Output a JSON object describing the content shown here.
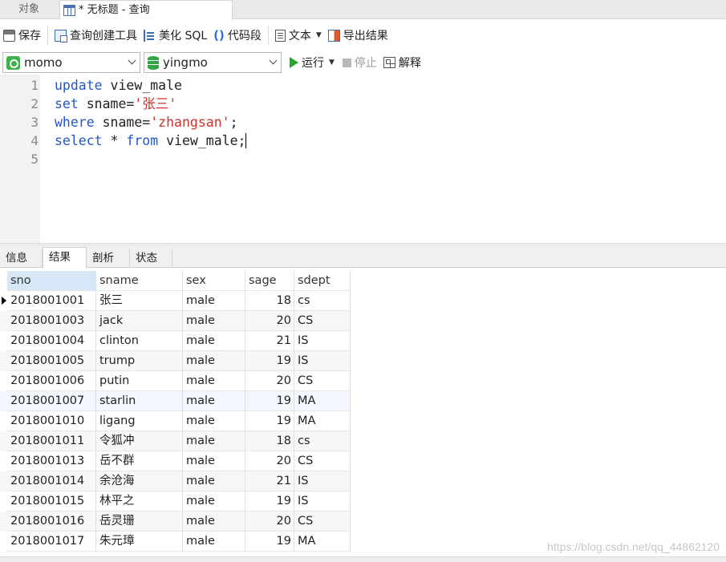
{
  "tabs": {
    "objects": "对象",
    "query": "* 无标题 - 查询"
  },
  "toolbar": {
    "save": "保存",
    "query_builder": "查询创建工具",
    "beautify_sql": "美化 SQL",
    "code_snippet": "代码段",
    "snippet_glyph": "()",
    "text": "文本",
    "export_result": "导出结果",
    "run": "运行",
    "stop": "停止",
    "explain": "解释"
  },
  "connection": {
    "selected": "momo"
  },
  "database": {
    "selected": "yingmo"
  },
  "editor": {
    "line_numbers": [
      "1",
      "2",
      "3",
      "4",
      "5"
    ],
    "lines": [
      [
        {
          "t": "update",
          "c": "kw"
        },
        {
          "t": " view_male",
          "c": ""
        }
      ],
      [
        {
          "t": "set",
          "c": "kw"
        },
        {
          "t": " sname=",
          "c": ""
        },
        {
          "t": "'张三'",
          "c": "str"
        }
      ],
      [
        {
          "t": "where",
          "c": "kw"
        },
        {
          "t": " sname=",
          "c": ""
        },
        {
          "t": "'zhangsan'",
          "c": "str"
        },
        {
          "t": ";",
          "c": ""
        }
      ],
      [
        {
          "t": "select",
          "c": "kw"
        },
        {
          "t": " * ",
          "c": ""
        },
        {
          "t": "from",
          "c": "kw"
        },
        {
          "t": " view_male;",
          "c": ""
        }
      ],
      []
    ],
    "cursor_line": 4
  },
  "result_tabs": [
    "信息",
    "结果 1",
    "剖析",
    "状态"
  ],
  "active_result_tab": "结果 1",
  "grid": {
    "columns": [
      "sno",
      "sname",
      "sex",
      "sage",
      "sdept"
    ],
    "rows": [
      [
        "2018001001",
        "张三",
        "male",
        "18",
        "cs"
      ],
      [
        "2018001003",
        "jack",
        "male",
        "20",
        "CS"
      ],
      [
        "2018001004",
        "clinton",
        "male",
        "21",
        "IS"
      ],
      [
        "2018001005",
        "trump",
        "male",
        "19",
        "IS"
      ],
      [
        "2018001006",
        "putin",
        "male",
        "20",
        "CS"
      ],
      [
        "2018001007",
        "starlin",
        "male",
        "19",
        "MA"
      ],
      [
        "2018001010",
        "ligang",
        "male",
        "19",
        "MA"
      ],
      [
        "2018001011",
        "令狐冲",
        "male",
        "18",
        "cs"
      ],
      [
        "2018001013",
        "岳不群",
        "male",
        "20",
        "CS"
      ],
      [
        "2018001014",
        "余沧海",
        "male",
        "21",
        "IS"
      ],
      [
        "2018001015",
        "林平之",
        "male",
        "19",
        "IS"
      ],
      [
        "2018001016",
        "岳灵珊",
        "male",
        "20",
        "CS"
      ],
      [
        "2018001017",
        "朱元璋",
        "male",
        "19",
        "MA"
      ]
    ],
    "current_row": 0
  },
  "watermark": "https://blog.csdn.net/qq_44862120",
  "colors": {
    "keyword": "#2256c8",
    "string": "#d0312d",
    "run_green": "#2aa52a",
    "header_selected": "#d6e8f7"
  }
}
